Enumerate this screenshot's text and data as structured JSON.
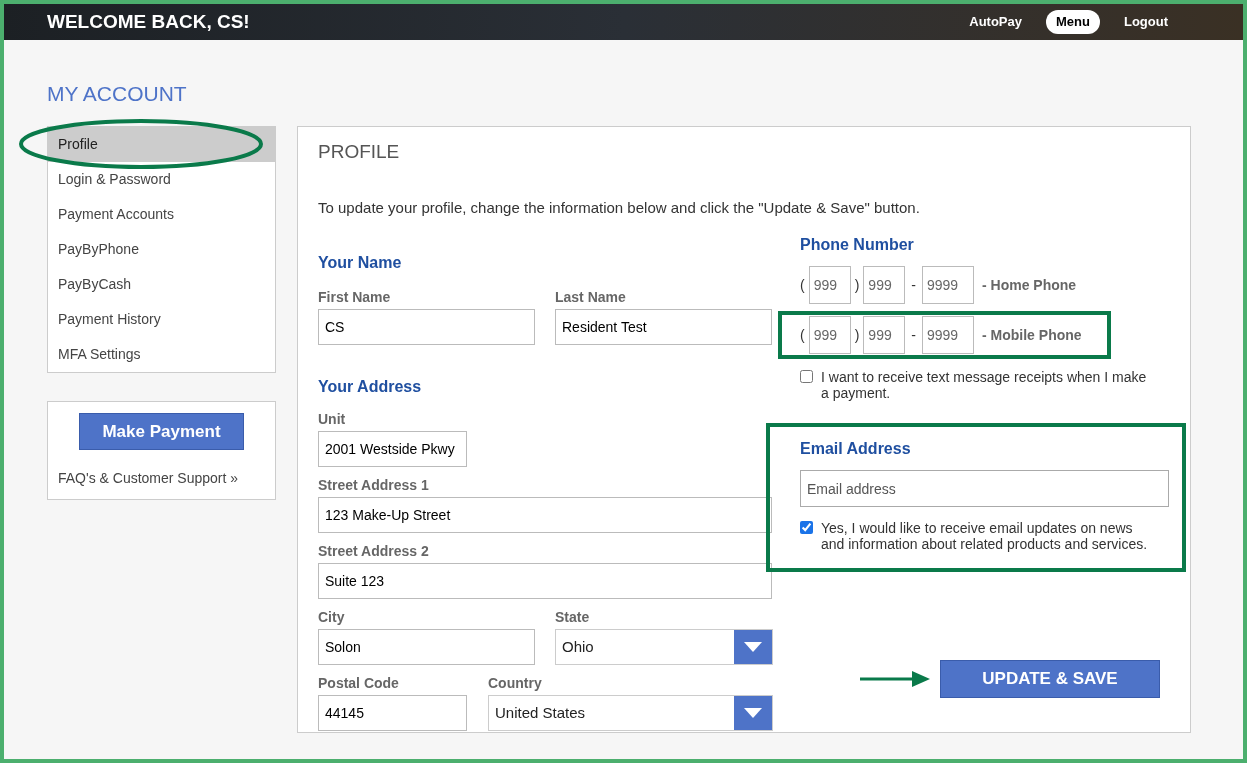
{
  "header": {
    "greeting": "WELCOME BACK, CS!",
    "links": [
      {
        "label": "AutoPay",
        "selected": false
      },
      {
        "label": "Menu",
        "selected": true
      },
      {
        "label": "Logout",
        "selected": false
      }
    ]
  },
  "page_title": "MY ACCOUNT",
  "sidebar": {
    "items": [
      {
        "label": "Profile",
        "selected": true
      },
      {
        "label": "Login & Password",
        "selected": false
      },
      {
        "label": "Payment Accounts",
        "selected": false
      },
      {
        "label": "PayByPhone",
        "selected": false
      },
      {
        "label": "PayByCash",
        "selected": false
      },
      {
        "label": "Payment History",
        "selected": false
      },
      {
        "label": "MFA Settings",
        "selected": false
      }
    ],
    "make_payment": "Make Payment",
    "support_link": "FAQ's & Customer Support »"
  },
  "profile": {
    "title": "PROFILE",
    "intro": "To update your profile, change the information below and click the \"Update & Save\" button.",
    "name_heading": "Your Name",
    "first_name": {
      "label": "First Name",
      "value": "CS"
    },
    "last_name": {
      "label": "Last Name",
      "value": "Resident Test"
    },
    "address_heading": "Your Address",
    "unit": {
      "label": "Unit",
      "value": "2001 Westside Pkwy"
    },
    "street1": {
      "label": "Street Address 1",
      "value": "123 Make-Up Street"
    },
    "street2": {
      "label": "Street Address 2",
      "value": "Suite 123"
    },
    "city": {
      "label": "City",
      "value": "Solon"
    },
    "state": {
      "label": "State",
      "value": "Ohio"
    },
    "postal": {
      "label": "Postal Code",
      "value": "44145"
    },
    "country": {
      "label": "Country",
      "value": "United States"
    },
    "phone_heading": "Phone Number",
    "phones": [
      {
        "open": "(",
        "area": {
          "placeholder": "999"
        },
        "close": ")",
        "prefix": {
          "placeholder": "999"
        },
        "dash": "-",
        "line": {
          "placeholder": "9999"
        },
        "label": "- Home Phone",
        "highlighted": false
      },
      {
        "open": "(",
        "area": {
          "placeholder": "999"
        },
        "close": ")",
        "prefix": {
          "placeholder": "999"
        },
        "dash": "-",
        "line": {
          "placeholder": "9999"
        },
        "label": "- Mobile Phone",
        "highlighted": true
      }
    ],
    "sms_opt_in": {
      "label": "I want to receive text message receipts when I make a payment.",
      "checked": false
    },
    "email_heading": "Email Address",
    "email": {
      "placeholder": "Email address"
    },
    "email_opt_in": {
      "label": "Yes, I would like to receive email updates on news and information about related products and services.",
      "checked": true
    },
    "save_button": "UPDATE & SAVE"
  }
}
